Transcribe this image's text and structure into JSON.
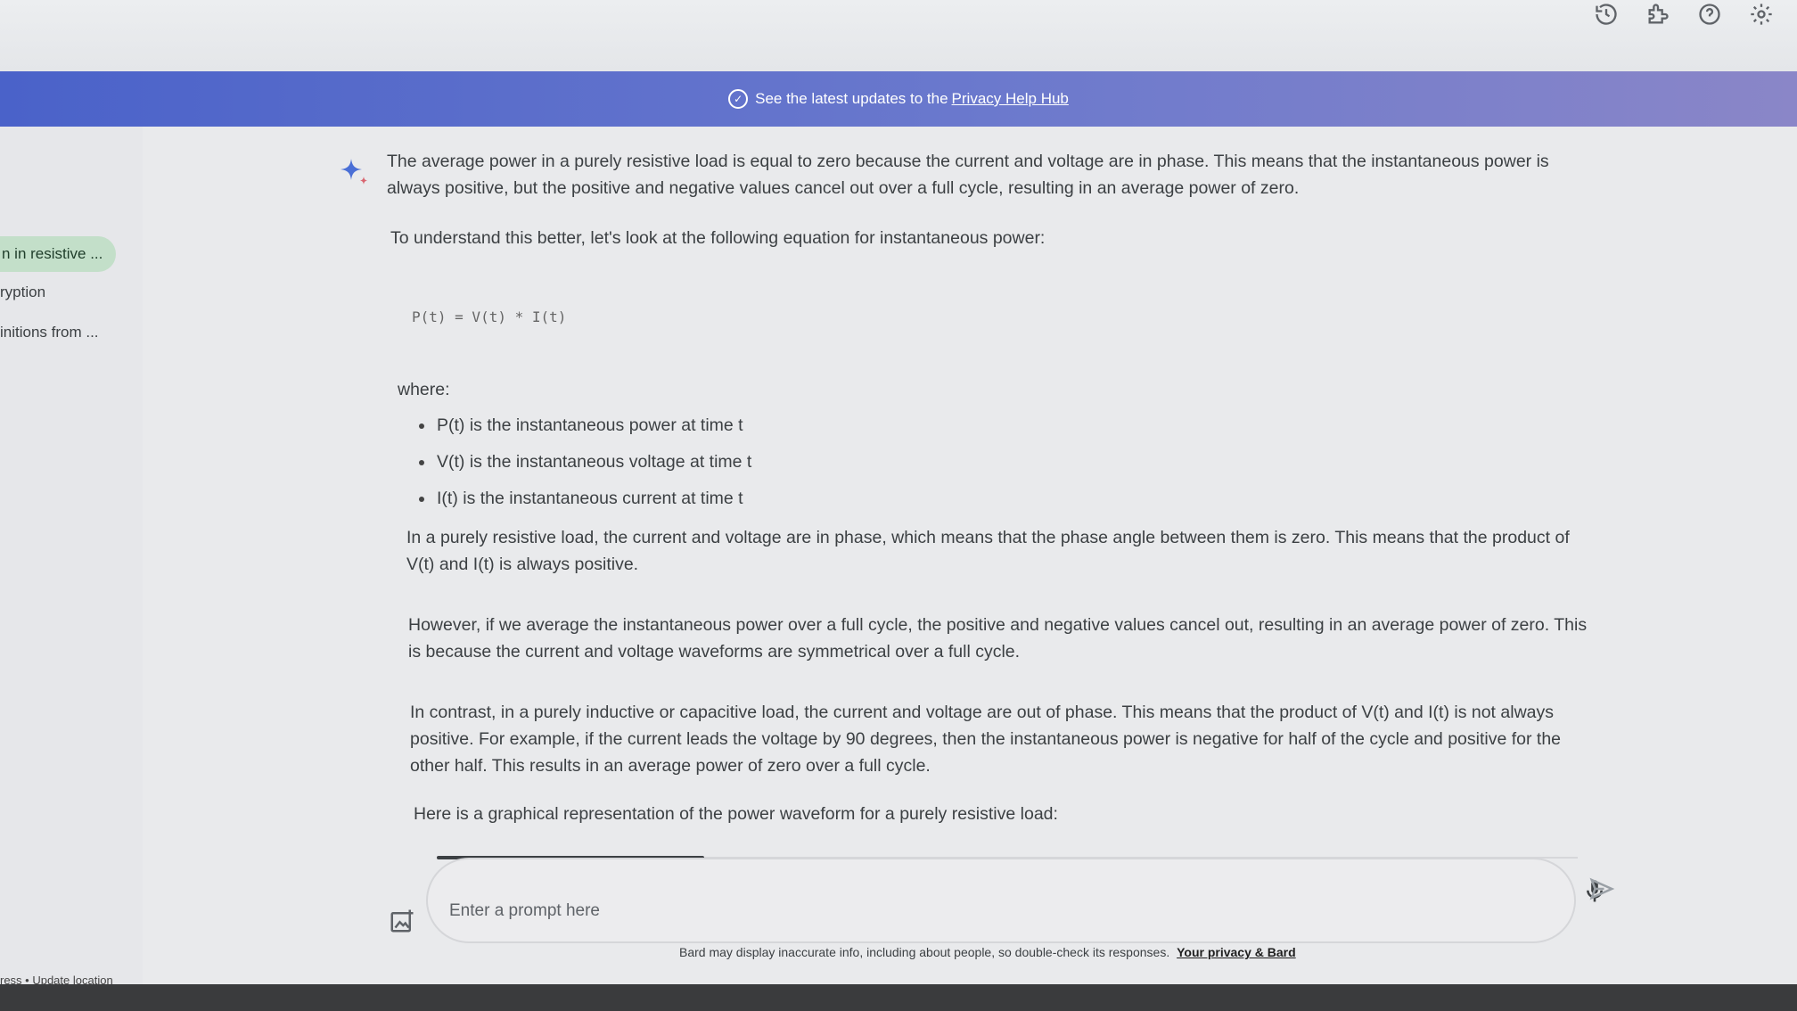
{
  "topbar": {
    "icons": [
      "history-icon",
      "extension-icon",
      "help-icon",
      "settings-icon"
    ]
  },
  "banner": {
    "text": "See the latest updates to the",
    "link": "Privacy Help Hub",
    "color": "#5a6ccb"
  },
  "sidebar": {
    "items": [
      {
        "label": "n in resistive ...",
        "active": true
      },
      {
        "label": "ryption"
      },
      {
        "label": "initions from ..."
      }
    ],
    "footer": "ress • Update location",
    "active_color": "#c3dfc9"
  },
  "response": {
    "p1": "The average power in a purely resistive load is equal to zero because the current and voltage are in phase. This means that the instantaneous power is always positive, but the positive and negative values cancel out over a full cycle, resulting in an average power of zero.",
    "p2": "To understand this better, let's look at the following equation for instantaneous power:",
    "code": "P(t) = V(t) * I(t)",
    "where": "where:",
    "bullets": [
      "P(t) is the instantaneous power at time t",
      "V(t) is the instantaneous voltage at time t",
      "I(t) is the instantaneous current at time t"
    ],
    "p3": "In a purely resistive load, the current and voltage are in phase, which means that the phase angle between them is zero. This means that the product of V(t) and I(t) is always positive.",
    "p4": "However, if we average the instantaneous power over a full cycle, the positive and negative values cancel out, resulting in an average power of zero. This is because the current and voltage waveforms are symmetrical over a full cycle.",
    "p5": "In contrast, in a purely inductive or capacitive load, the current and voltage are out of phase. This means that the product of V(t) and I(t) is not always positive. For example, if the current leads the voltage by 90 degrees, then the instantaneous power is negative for half of the cycle and positive for the other half. This results in an average power of zero over a full cycle.",
    "p6": "Here is a graphical representation of the power waveform for a purely resistive load:"
  },
  "prompt": {
    "placeholder": "Enter a prompt here",
    "value": ""
  },
  "disclaimer": {
    "text": "Bard may display inaccurate info, including about people, so double-check its responses.",
    "link": "Your privacy & Bard"
  }
}
